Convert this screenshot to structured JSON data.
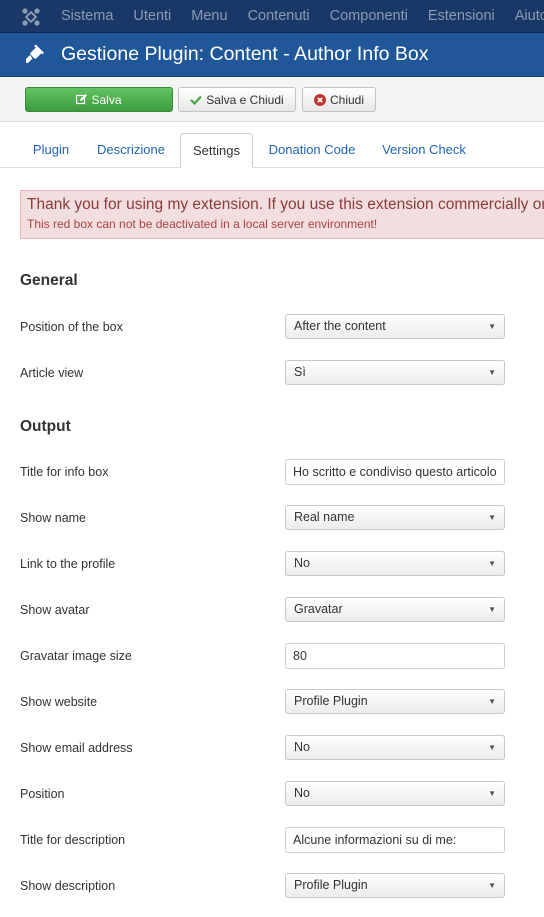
{
  "navbar": {
    "items": [
      "Sistema",
      "Utenti",
      "Menu",
      "Contenuti",
      "Componenti",
      "Estensioni",
      "Aiuto"
    ]
  },
  "header": {
    "title": "Gestione Plugin: Content - Author Info Box"
  },
  "toolbar": {
    "save_label": "Salva",
    "save_close_label": "Salva e Chiudi",
    "close_label": "Chiudi",
    "colors": {
      "save": "#46a546",
      "close_icon": "#bd362f",
      "check_icon": "#46a546"
    }
  },
  "tabs": [
    {
      "label": "Plugin",
      "active": false
    },
    {
      "label": "Descrizione",
      "active": false
    },
    {
      "label": "Settings",
      "active": true
    },
    {
      "label": "Donation Code",
      "active": false
    },
    {
      "label": "Version Check",
      "active": false
    }
  ],
  "alert": {
    "title": "Thank you for using my extension. If you use this extension commercially or w",
    "subtitle": "This red box can not be deactivated in a local server environment!"
  },
  "sections": {
    "general": "General",
    "output": "Output"
  },
  "fields": {
    "position_box": {
      "label": "Position of the box",
      "value": "After the content"
    },
    "article_view": {
      "label": "Article view",
      "value": "Sì"
    },
    "title_info_box": {
      "label": "Title for info box",
      "value": "Ho scritto e condiviso questo articolo"
    },
    "show_name": {
      "label": "Show name",
      "value": "Real name"
    },
    "link_profile": {
      "label": "Link to the profile",
      "value": "No"
    },
    "show_avatar": {
      "label": "Show avatar",
      "value": "Gravatar"
    },
    "gravatar_size": {
      "label": "Gravatar image size",
      "value": "80"
    },
    "show_website": {
      "label": "Show website",
      "value": "Profile Plugin"
    },
    "show_email": {
      "label": "Show email address",
      "value": "No"
    },
    "position": {
      "label": "Position",
      "value": "No"
    },
    "title_description": {
      "label": "Title for description",
      "value": "Alcune informazioni su di me:"
    },
    "show_description": {
      "label": "Show description",
      "value": "Profile Plugin"
    }
  }
}
